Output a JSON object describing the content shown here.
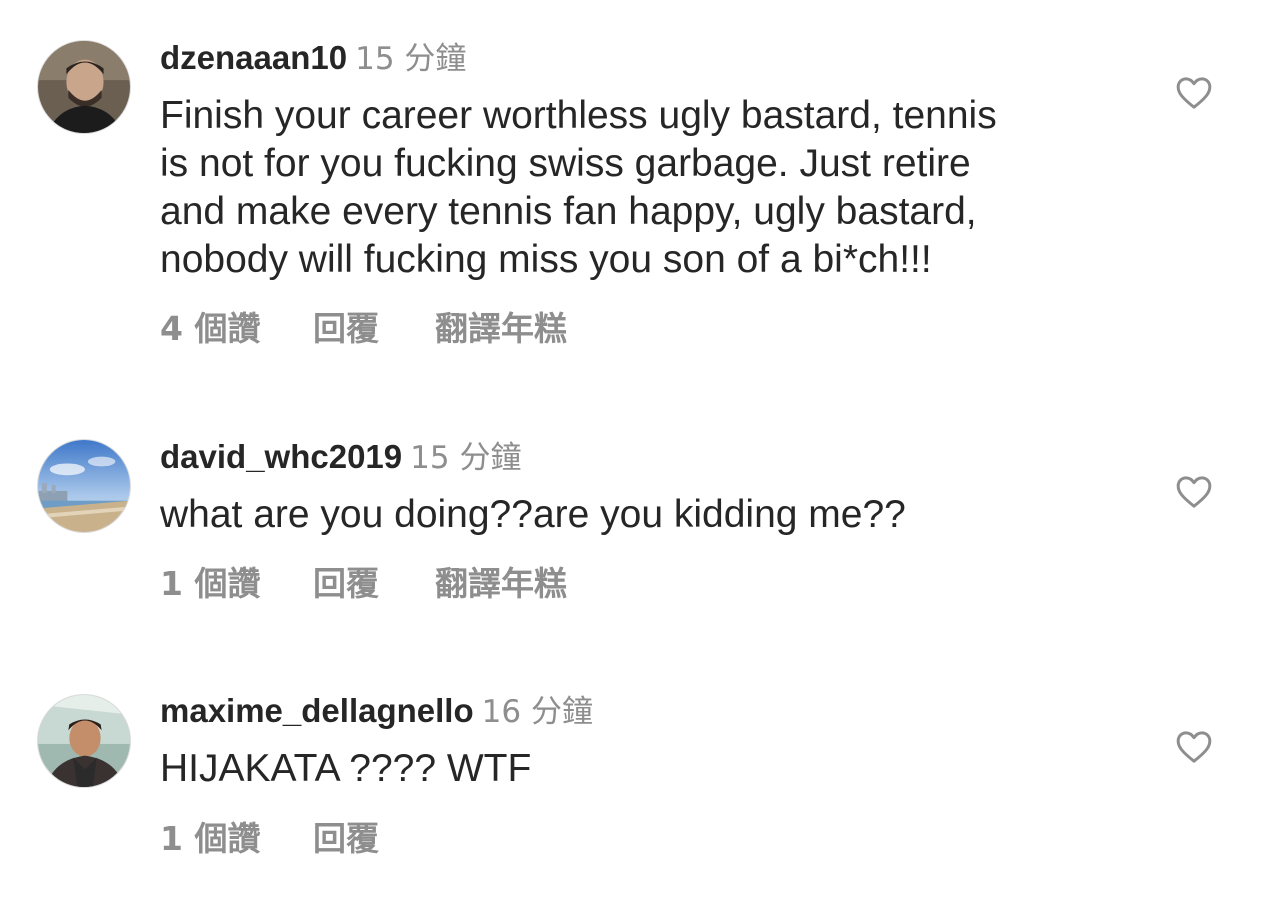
{
  "comments": [
    {
      "username": "dzenaaan10",
      "time": "15 分鐘",
      "text": "Finish your career worthless ugly bastard, tennis\nis not for you fucking swiss garbage. Just retire\nand make every tennis fan happy, ugly bastard,\nnobody will fucking miss you son of a bi*ch!!!",
      "likes": "4 個讚",
      "reply": "回覆",
      "translate": "翻譯年糕",
      "avatar_icon": "person-photo",
      "like_icon": "heart-outline-icon"
    },
    {
      "username": "david_whc2019",
      "time": "15 分鐘",
      "text": "what are you doing??are you kidding me??",
      "likes": "1 個讚",
      "reply": "回覆",
      "translate": "翻譯年糕",
      "avatar_icon": "beach-photo",
      "like_icon": "heart-outline-icon"
    },
    {
      "username": "maxime_dellagnello",
      "time": "16 分鐘",
      "text": "HIJAKATA ???? WTF",
      "likes": "1 個讚",
      "reply": "回覆",
      "avatar_icon": "person-photo",
      "like_icon": "heart-outline-icon"
    }
  ],
  "colors": {
    "text": "#262626",
    "secondary": "#8e8e8e",
    "background": "#ffffff"
  }
}
